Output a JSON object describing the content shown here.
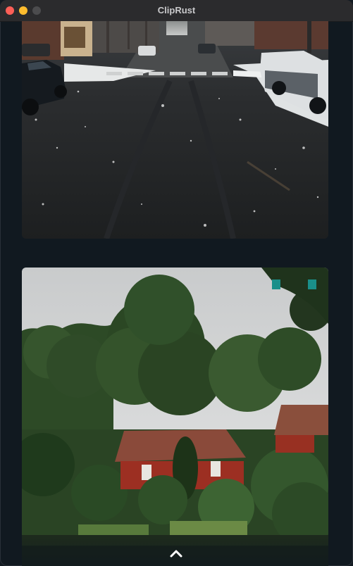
{
  "window": {
    "title": "ClipRust"
  },
  "clips": [
    {
      "kind": "image",
      "description_icon": "image-icon"
    },
    {
      "kind": "image",
      "description_icon": "image-icon"
    }
  ],
  "controls": {
    "scroll_top_icon": "chevron-up-icon"
  },
  "colors": {
    "background": "#111920",
    "titlebar": "#2b2b2d",
    "close": "#fe5f57",
    "minimize": "#febc2e",
    "maximize": "#4c4c4e",
    "accent_marker": "#1a8f8a"
  }
}
